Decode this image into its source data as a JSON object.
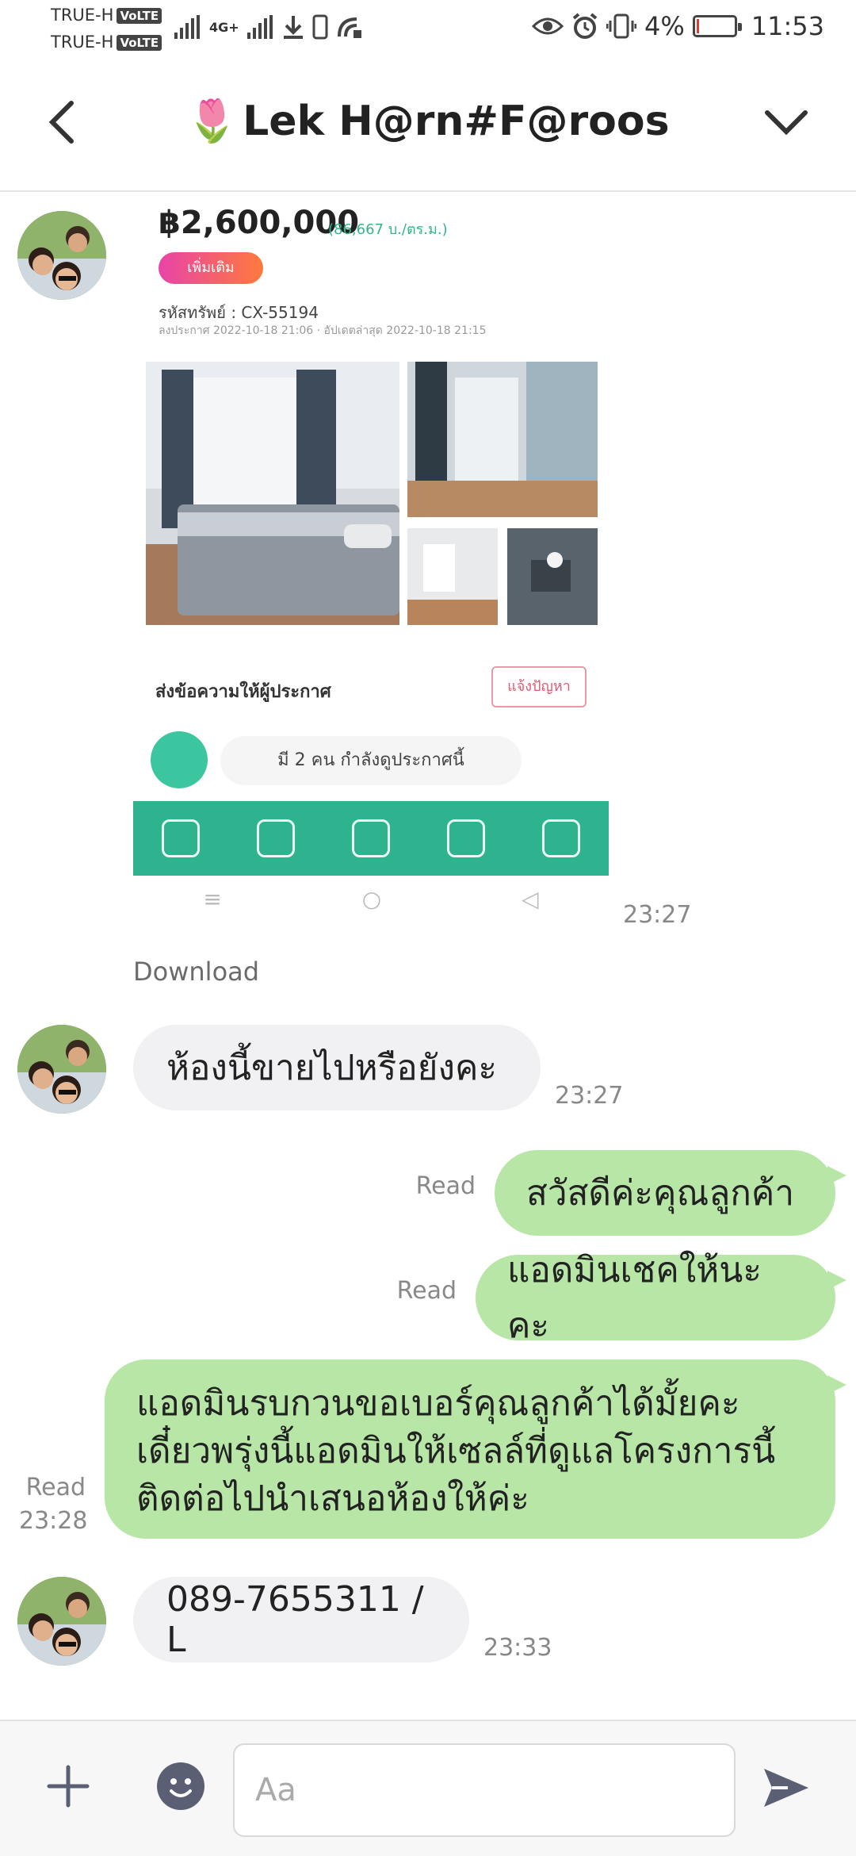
{
  "status_bar": {
    "carrier1": "TRUE-H",
    "carrier2": "TRUE-H",
    "volte": "VoLTE",
    "network": "4G+",
    "battery_percent": "4%",
    "time": "11:53",
    "icons": [
      "signal-icon",
      "download-icon",
      "sim-icon",
      "eye-icon",
      "alarm-icon",
      "vibrate-icon",
      "battery-icon"
    ]
  },
  "header": {
    "title_emoji": "🌷",
    "title": "Lek  H@rn#F@roos"
  },
  "shared_image": {
    "price": "฿2,600,000",
    "price_sub": "(86,667 บ./ตร.ม.)",
    "tag": "เพิ่มเติม",
    "code": "รหัสทรัพย์ : CX-55194",
    "meta": "ลงประกาศ 2022-10-18 21:06 · อัปเดตล่าสุด 2022-10-18 21:15",
    "contact": "ส่งข้อความให้ผู้ประกาศ",
    "contact_btn": "แจ้งปัญหา",
    "viewer_text": "มี 2 คน กำลังดูประกาศนี้"
  },
  "messages": {
    "img_time": "23:27",
    "download": "Download",
    "m1": {
      "text": "ห้องนี้ขายไปหรือยังคะ",
      "time": "23:27"
    },
    "m2": {
      "text": "สวัสดีค่ะคุณลูกค้า",
      "status": "Read"
    },
    "m3": {
      "text": "แอดมินเชคให้นะคะ",
      "status": "Read"
    },
    "m4": {
      "lines": [
        "แอดมินรบกวนขอเบอร์คุณลูกค้าได้มั้ยคะ",
        "เดี๋ยวพรุ่งนี้แอดมินให้เซลล์ที่ดูแลโครงการนี้",
        "ติดต่อไปนำเสนอห้องให้ค่ะ"
      ],
      "status": "Read",
      "time": "23:28"
    },
    "m5": {
      "text": "089-7655311 / L",
      "time": "23:33"
    }
  },
  "input": {
    "placeholder": "Aa"
  },
  "colors": {
    "outgoing_bubble": "#b7e6a7",
    "incoming_bubble": "#f1f1f3",
    "app_bar_green": "#2fb28e"
  }
}
